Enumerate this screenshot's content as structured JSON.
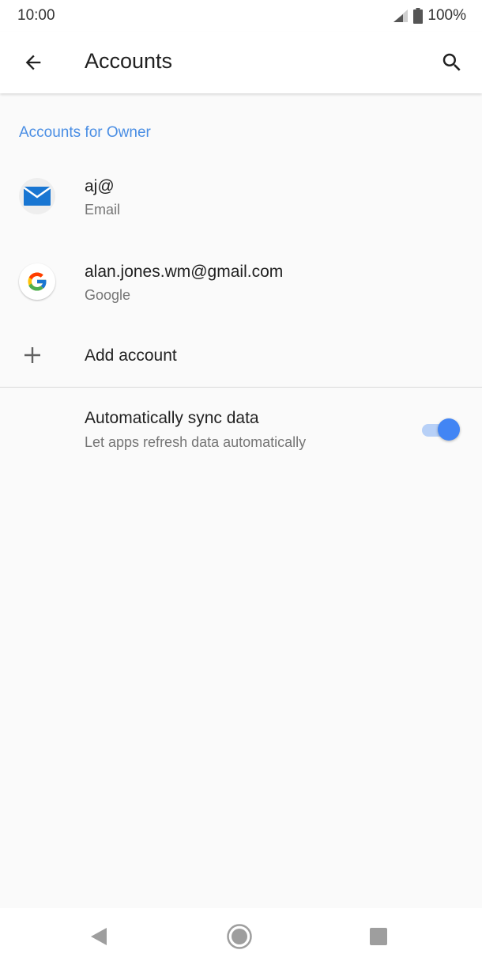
{
  "status_bar": {
    "time": "10:00",
    "battery": "100%",
    "icons": [
      "signal-icon",
      "battery-icon"
    ]
  },
  "app_bar": {
    "title": "Accounts",
    "icons": [
      "back-arrow-icon",
      "search-icon"
    ]
  },
  "section": {
    "header": "Accounts for Owner"
  },
  "accounts": [
    {
      "name": "aj@",
      "type": "Email",
      "icon": "email-icon"
    },
    {
      "name": "alan.jones.wm@gmail.com",
      "type": "Google",
      "icon": "google-icon"
    }
  ],
  "add_account": {
    "label": "Add account",
    "icon": "plus-icon"
  },
  "sync": {
    "title": "Automatically sync data",
    "subtitle": "Let apps refresh data automatically",
    "enabled": true
  },
  "nav_bar": {
    "icons": [
      "back-triangle-icon",
      "home-circle-icon",
      "recents-square-icon"
    ]
  },
  "colors": {
    "accent": "#4285f4",
    "section_header": "#4a8ee4",
    "background": "#fafafa"
  }
}
